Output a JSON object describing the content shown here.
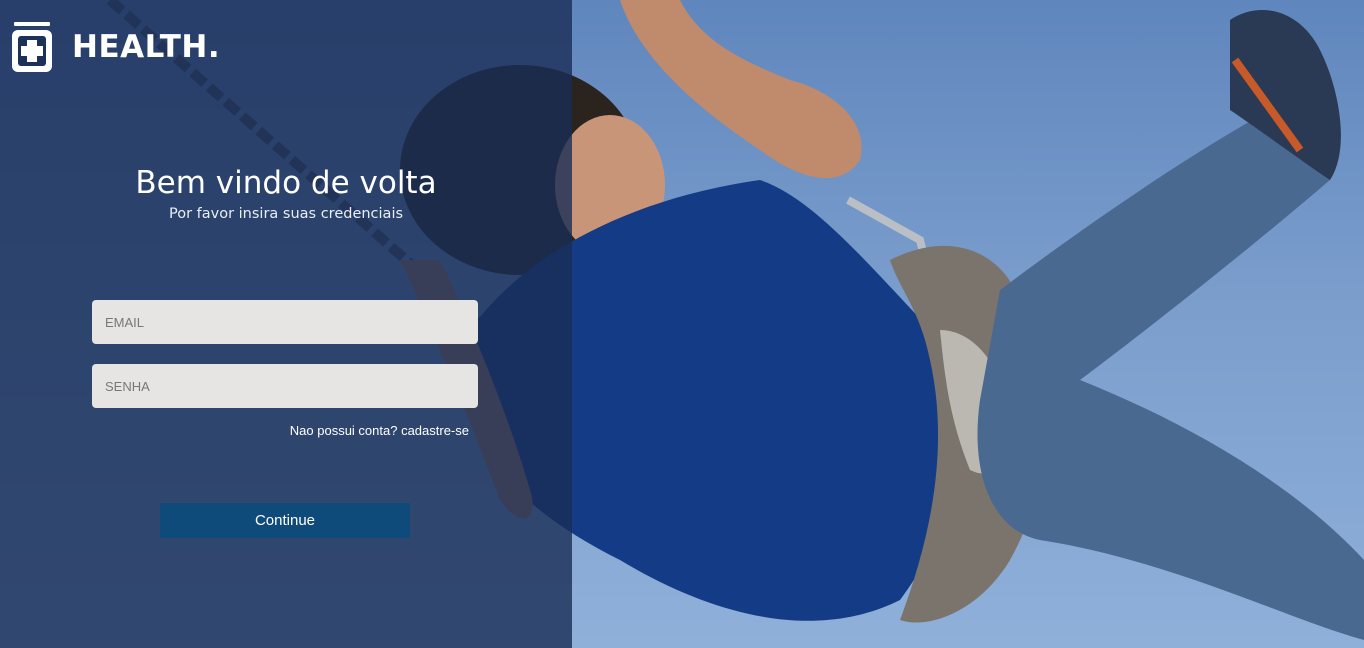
{
  "brand": {
    "name": "HEALTH.",
    "logo_icon": "medicine-cross-icon"
  },
  "login": {
    "title": "Bem vindo de volta",
    "subtitle": "Por favor insira suas credenciais",
    "email_placeholder": "EMAIL",
    "password_placeholder": "SENHA",
    "signup_link": "Nao possui conta? cadastre-se",
    "continue_label": "Continue"
  },
  "colors": {
    "panel_overlay": "#192d55",
    "button": "#0e4a7a",
    "input_bg": "#e6e5e4",
    "sky": "#7a9dcc"
  }
}
